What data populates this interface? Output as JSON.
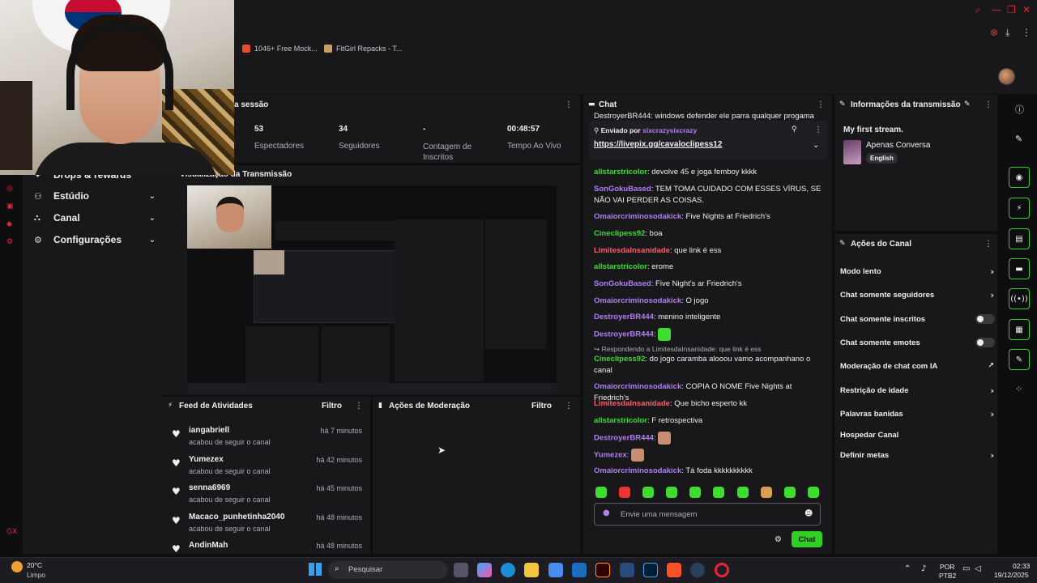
{
  "browser": {
    "bookmarks": [
      {
        "label": "1046+ Free Mock...",
        "color": "#e44d26"
      },
      {
        "label": "FitGirl Repacks - T...",
        "color": "#c8a060"
      }
    ]
  },
  "sidebar": {
    "items": [
      {
        "label": "Drops & rewards",
        "icon": "gift-icon"
      },
      {
        "label": "Estúdio",
        "icon": "studio-icon"
      },
      {
        "label": "Canal",
        "icon": "channel-icon"
      },
      {
        "label": "Configurações",
        "icon": "gear-icon"
      }
    ]
  },
  "session": {
    "title": "a sessão",
    "stats": [
      {
        "value": "53",
        "label": "Espectadores"
      },
      {
        "value": "34",
        "label": "Seguidores"
      },
      {
        "value": "-",
        "label": "Contagem de Inscritos"
      },
      {
        "value": "00:48:57",
        "label": "Tempo Ao Vivo"
      }
    ]
  },
  "preview": {
    "title": "Visualização da Transmissão"
  },
  "activity_feed": {
    "title": "Feed de Atividades",
    "filter": "Filtro",
    "items": [
      {
        "name": "iangabriell",
        "time": "há 7 minutos",
        "sub": "acabou de seguir o canal"
      },
      {
        "name": "Yumezex",
        "time": "há 42 minutos",
        "sub": "acabou de seguir o canal"
      },
      {
        "name": "senna6969",
        "time": "há 45 minutos",
        "sub": "acabou de seguir o canal"
      },
      {
        "name": "Macaco_punhetinha2040",
        "time": "há 48 minutos",
        "sub": "acabou de seguir o canal"
      },
      {
        "name": "AndinMah",
        "time": "há 48 minutos",
        "sub": ""
      }
    ]
  },
  "moderation": {
    "title": "Ações de Moderação",
    "filter": "Filtro"
  },
  "chat": {
    "title": "Chat",
    "top_cut": "DestroyerBR444: windows defender ele parra qualquer progama",
    "pinned_by_label": "Enviado por",
    "pinned_by_user": "sixcrazysixcrazy",
    "pinned_link": "https://livepix.gg/cavaloclipess12",
    "reply_note": "Respondendo a LimitesdaInsanidade: que link é ess",
    "messages": [
      {
        "user": "allstarstricolor",
        "color": "#3ddc2f",
        "text": "devolve 45 e joga femboy kkkk"
      },
      {
        "user": "SonGokuBased",
        "color": "#b57cf7",
        "text": "TEM TOMA CUIDADO COM ESSES VÍRUS, SE NÃO VAI PERDER AS COISAS."
      },
      {
        "user": "Omaiorcriminosodakick",
        "color": "#b57cf7",
        "text": "Five Nights at Friedrich's"
      },
      {
        "user": "Cineclipess92",
        "color": "#3ddc2f",
        "text": "boa"
      },
      {
        "user": "LimitesdaInsanidade",
        "color": "#ff5b6b",
        "text": "que link é ess"
      },
      {
        "user": "allstarstricolor",
        "color": "#3ddc2f",
        "text": "erome"
      },
      {
        "user": "SonGokuBased",
        "color": "#b57cf7",
        "text": "Five Night's ar Friedrich's"
      },
      {
        "user": "Omaiorcriminosodakick",
        "color": "#b57cf7",
        "text": "O jogo"
      },
      {
        "user": "DestroyerBR444",
        "color": "#b57cf7",
        "text": "menino inteligente"
      },
      {
        "user": "DestroyerBR444",
        "color": "#b57cf7",
        "text": ""
      },
      {
        "user": "Cineclipess92",
        "color": "#3ddc2f",
        "text": "do jogo caramba alooou vamo acompanhano o canal"
      },
      {
        "user": "Omaiorcriminosodakick",
        "color": "#b57cf7",
        "text": "COPIA O NOME Five Nights at Friedrich's"
      },
      {
        "user": "LimitesdaInsanidade",
        "color": "#ff5b6b",
        "text": "Que bicho esperto kk"
      },
      {
        "user": "allstarstricolor",
        "color": "#3ddc2f",
        "text": "F retrospectiva"
      },
      {
        "user": "DestroyerBR444",
        "color": "#b57cf7",
        "text": ""
      },
      {
        "user": "Yumezex",
        "color": "#b57cf7",
        "text": ""
      },
      {
        "user": "Omaiorcriminosodakick",
        "color": "#b57cf7",
        "text": "Tá foda kkkkkkkkkk"
      }
    ],
    "input_placeholder": "Envie uma mensagem",
    "send_label": "Chat"
  },
  "stream_info": {
    "title": "Informações da transmissão",
    "stream_title": "My first stream.",
    "category": "Apenas Conversa",
    "language": "English"
  },
  "channel_actions": {
    "title": "Ações do Canal",
    "items": [
      {
        "label": "Modo lento",
        "control": "chevron"
      },
      {
        "label": "Chat somente seguidores",
        "control": "chevron"
      },
      {
        "label": "Chat somente inscritos",
        "control": "toggle"
      },
      {
        "label": "Chat somente emotes",
        "control": "toggle"
      },
      {
        "label": "Moderação de chat com IA",
        "control": "external"
      },
      {
        "label": "Restrição de idade",
        "control": "chevron"
      },
      {
        "label": "Palavras banidas",
        "control": "chevron"
      },
      {
        "label": "Hospedar Canal",
        "control": "none"
      },
      {
        "label": "Definir metas",
        "control": "chevron"
      }
    ]
  },
  "taskbar": {
    "weather_temp": "20°C",
    "weather_desc": "Limpo",
    "search_label": "Pesquisar",
    "lang_top": "POR",
    "lang_bottom": "PTB2",
    "time": "02:33",
    "date": "19/12/2025"
  },
  "colors": {
    "accent": "#2fd023",
    "bg": "#0e0e10",
    "panel": "#18181b"
  }
}
